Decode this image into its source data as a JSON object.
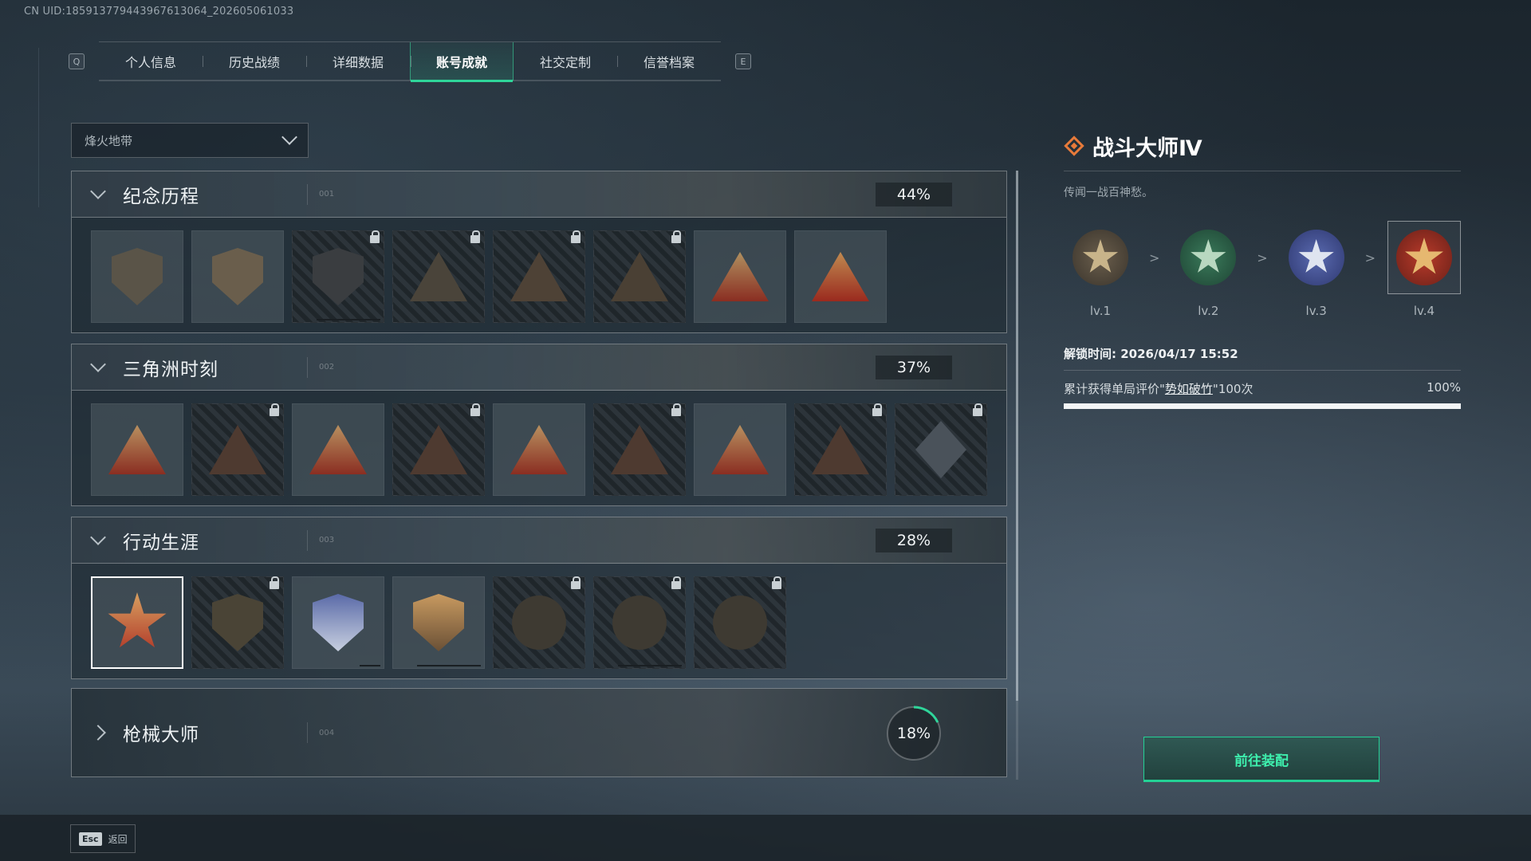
{
  "uid": "CN UID:185913779443967613064_202605061033",
  "tabs": {
    "left_key": "Q",
    "right_key": "E",
    "items": [
      {
        "label": "个人信息"
      },
      {
        "label": "历史战绩"
      },
      {
        "label": "详细数据"
      },
      {
        "label": "账号成就"
      },
      {
        "label": "社交定制"
      },
      {
        "label": "信誉档案"
      }
    ],
    "active_index": 3
  },
  "mode_select": {
    "value": "烽火地带"
  },
  "sections": [
    {
      "title": "纪念历程",
      "code": "001",
      "percent": "44%",
      "expanded": true
    },
    {
      "title": "三角洲时刻",
      "code": "002",
      "percent": "37%",
      "expanded": true
    },
    {
      "title": "行动生涯",
      "code": "003",
      "percent": "28%",
      "expanded": true
    },
    {
      "title": "枪械大师",
      "code": "004",
      "percent": "18%",
      "percent_value": 0.18,
      "expanded": false
    }
  ],
  "detail": {
    "title": "战斗大师Ⅳ",
    "description": "传闻一战百神愁。",
    "levels": [
      {
        "label": "lv.1"
      },
      {
        "label": "lv.2"
      },
      {
        "label": "lv.3"
      },
      {
        "label": "lv.4"
      }
    ],
    "level_separator": ">",
    "unlock_time": "解锁时间: 2026/04/17 15:52",
    "progress_prefix": "累计获得单局评价\"",
    "progress_highlight": "势如破竹",
    "progress_suffix": "\"100次",
    "progress_percent": "100%",
    "progress_value": 1.0
  },
  "equip_button": {
    "label": "前往装配"
  },
  "footer": {
    "esc_key": "Esc",
    "back_label": "返回"
  },
  "colors": {
    "accent": "#2fd59a",
    "title_icon": "#e77a3a",
    "button_text": "#3ef0ae"
  }
}
